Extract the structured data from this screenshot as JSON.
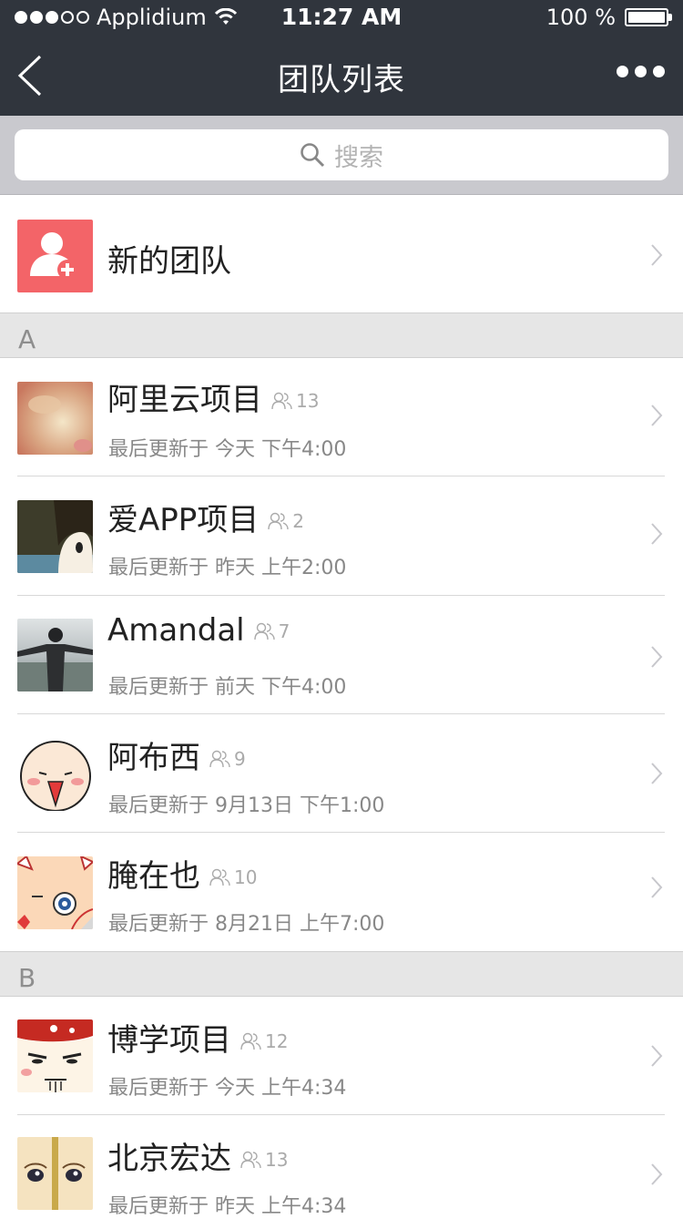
{
  "status_bar": {
    "carrier": "Applidium",
    "time": "11:27 AM",
    "battery": "100 %",
    "battery_level": 1.0,
    "signal_bars": 3
  },
  "nav": {
    "title": "团队列表",
    "back_icon": "chevron-left-icon",
    "more_icon": "more-horizontal-icon"
  },
  "search": {
    "placeholder": "搜索",
    "icon": "search-icon"
  },
  "new_team": {
    "label": "新的团队",
    "icon": "add-user-icon",
    "color": "#f36468"
  },
  "sections": [
    {
      "letter": "A",
      "items": [
        {
          "name": "阿里云项目",
          "count": "13",
          "updated_prefix": "最后更新于",
          "updated": "今天 下午4:00"
        },
        {
          "name": "爱APP项目",
          "count": "2",
          "updated_prefix": "最后更新于",
          "updated": "昨天 上午2:00"
        },
        {
          "name": "Amandal",
          "count": "7",
          "updated_prefix": "最后更新于",
          "updated": "前天 下午4:00"
        },
        {
          "name": "阿布西",
          "count": "9",
          "updated_prefix": "最后更新于",
          "updated": "9月13日 下午1:00"
        },
        {
          "name": "腌在也",
          "count": "10",
          "updated_prefix": "最后更新于",
          "updated": "8月21日 上午7:00"
        }
      ]
    },
    {
      "letter": "B",
      "items": [
        {
          "name": "博学项目",
          "count": "12",
          "updated_prefix": "最后更新于",
          "updated": "今天 上午4:34"
        },
        {
          "name": "北京宏达",
          "count": "13",
          "updated_prefix": "最后更新于",
          "updated": "昨天 上午4:34"
        }
      ]
    }
  ]
}
